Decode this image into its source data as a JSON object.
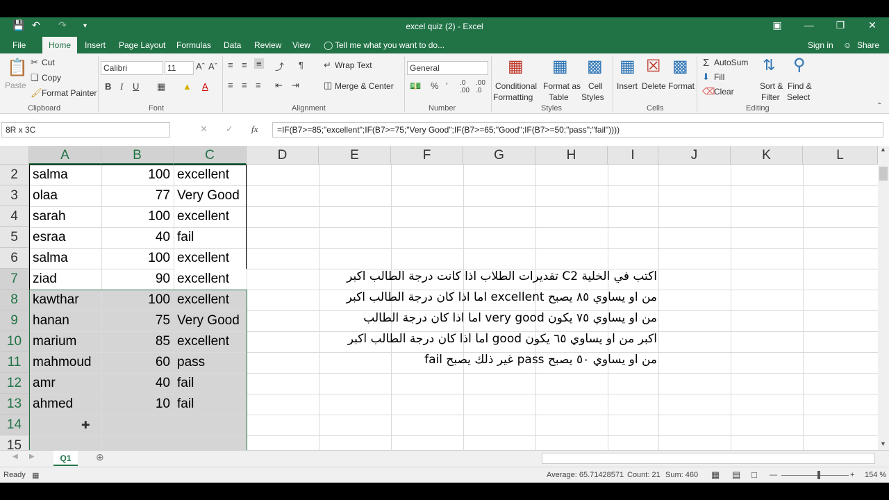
{
  "window": {
    "title": "excel quiz (2) - Excel",
    "sign_in": "Sign in",
    "share": "Share"
  },
  "tabs": [
    "File",
    "Home",
    "Insert",
    "Page Layout",
    "Formulas",
    "Data",
    "Review",
    "View"
  ],
  "tell_me": "Tell me what you want to do...",
  "clipboard": {
    "paste": "Paste",
    "cut": "Cut",
    "copy": "Copy",
    "format_painter": "Format Painter",
    "label": "Clipboard"
  },
  "font": {
    "name": "Calibri",
    "size": "11",
    "label": "Font"
  },
  "alignment": {
    "wrap": "Wrap Text",
    "merge": "Merge & Center",
    "label": "Alignment"
  },
  "number": {
    "format": "General",
    "label": "Number"
  },
  "styles": {
    "conditional": "Conditional",
    "conditional2": "Formatting",
    "format_as": "Format as",
    "table": "Table",
    "cell": "Cell",
    "cell2": "Styles",
    "label": "Styles"
  },
  "cells": {
    "insert": "Insert",
    "delete": "Delete",
    "format": "Format",
    "label": "Cells"
  },
  "editing": {
    "autosum": "AutoSum",
    "fill": "Fill",
    "clear": "Clear",
    "sort": "Sort &",
    "sort2": "Filter",
    "find": "Find &",
    "find2": "Select",
    "label": "Editing"
  },
  "namebox": "8R x 3C",
  "formula": "=IF(B7>=85;\"excellent\";IF(B7>=75;\"Very Good\";IF(B7>=65;\"Good\";IF(B7>=50;\"pass\";\"fail\"))))",
  "columns": [
    "A",
    "B",
    "C",
    "D",
    "E",
    "F",
    "G",
    "H",
    "I",
    "J",
    "K",
    "L"
  ],
  "rows": [
    {
      "n": "2",
      "a": "salma",
      "b": "100",
      "c": "excellent"
    },
    {
      "n": "3",
      "a": "olaa",
      "b": "77",
      "c": "Very Good"
    },
    {
      "n": "4",
      "a": "sarah",
      "b": "100",
      "c": "excellent"
    },
    {
      "n": "5",
      "a": "esraa",
      "b": "40",
      "c": "fail"
    },
    {
      "n": "6",
      "a": "salma",
      "b": "100",
      "c": "excellent"
    },
    {
      "n": "7",
      "a": "ziad",
      "b": "90",
      "c": "excellent"
    },
    {
      "n": "8",
      "a": "kawthar",
      "b": "100",
      "c": "excellent"
    },
    {
      "n": "9",
      "a": "hanan",
      "b": "75",
      "c": "Very Good"
    },
    {
      "n": "10",
      "a": "marium",
      "b": "85",
      "c": "excellent"
    },
    {
      "n": "11",
      "a": "mahmoud",
      "b": "60",
      "c": "pass"
    },
    {
      "n": "12",
      "a": "amr",
      "b": "40",
      "c": "fail"
    },
    {
      "n": "13",
      "a": "ahmed",
      "b": "10",
      "c": "fail"
    },
    {
      "n": "14",
      "a": "",
      "b": "",
      "c": ""
    },
    {
      "n": "15",
      "a": "",
      "b": "",
      "c": ""
    }
  ],
  "note_lines": [
    "اكتب في الخلية C2 تقديرات الطلاب اذا كانت درجة الطالب اكبر",
    "من او يساوي ٨٥ يصبح excellent اما اذا كان درجة الطالب اكبر",
    "من او يساوي ٧٥ يكون very good اما اذا كان درجة الطالب",
    "اكبر من او يساوي ٦٥ يكون good اما اذا كان درجة الطالب اكبر",
    "من او يساوي ٥٠ يصبح pass غير ذلك يصبح fail"
  ],
  "sheet_tab": "Q1",
  "status": {
    "ready": "Ready",
    "average": "Average: 65.71428571",
    "count": "Count: 21",
    "sum": "Sum: 460",
    "zoom": "154 %"
  }
}
